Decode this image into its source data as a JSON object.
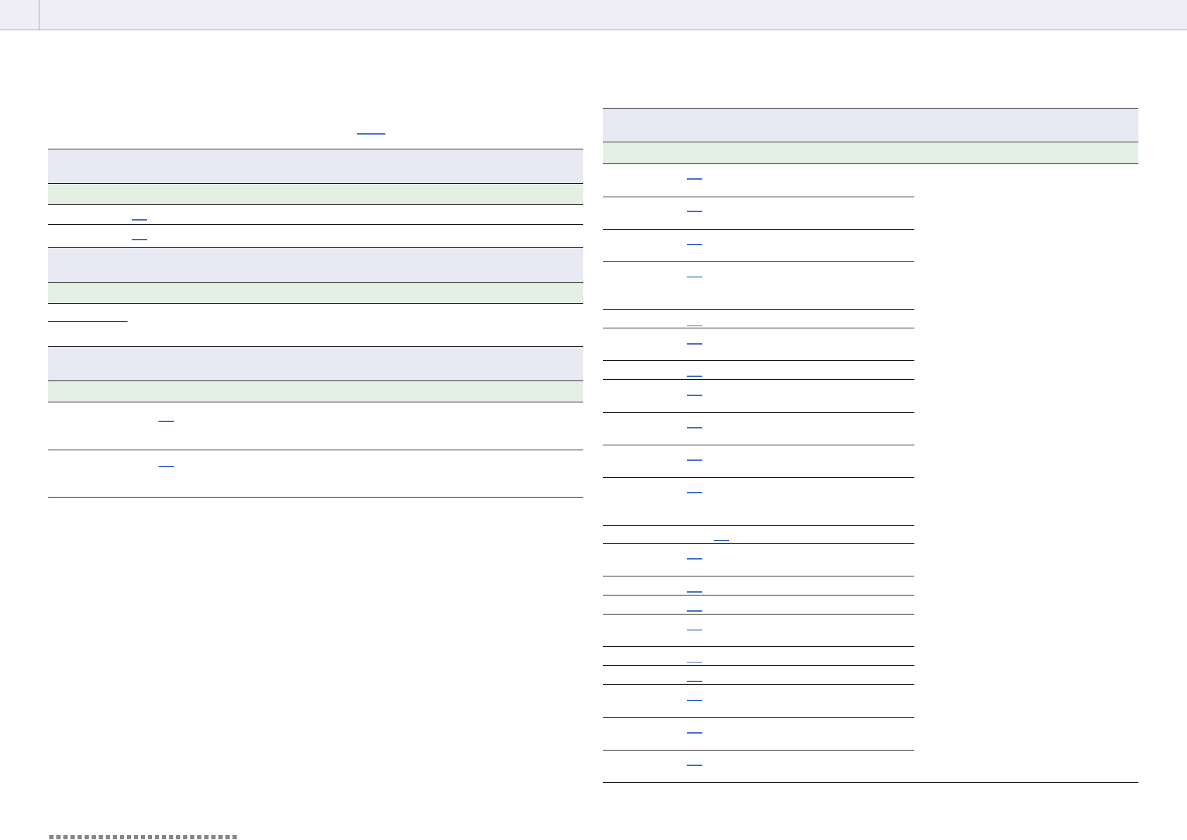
{
  "colors": {
    "header_band": "#e9e9f4",
    "subheader_band": "#e4f0e4",
    "rule": "#111111",
    "link": "#3b6cc7",
    "link_faint": "#9ab5e6",
    "top_bar": "#eeeef4",
    "top_bar_border": "#9aa3c4"
  },
  "left_tables": {
    "table_count": 3
  },
  "right_table": {
    "row_count": 23
  }
}
